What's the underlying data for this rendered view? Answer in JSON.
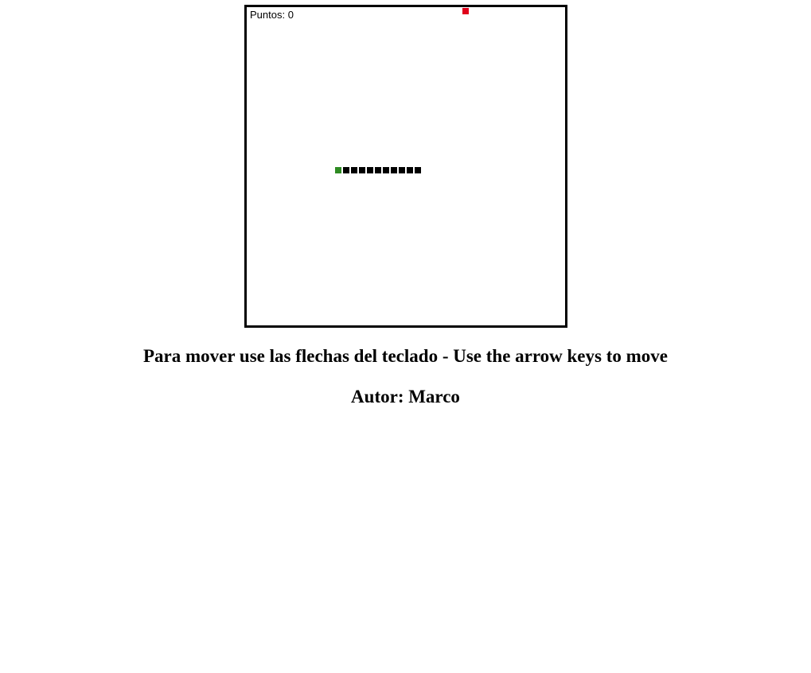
{
  "game": {
    "score_label": "Puntos: 0",
    "score": 0,
    "colors": {
      "board_border": "#000000",
      "snake_head": "#2e8b22",
      "snake_body": "#000000",
      "food": "#e0001b"
    },
    "grid_size": 40,
    "snake": {
      "direction": "left",
      "head": [
        11,
        20
      ],
      "body": [
        [
          12,
          20
        ],
        [
          13,
          20
        ],
        [
          14,
          20
        ],
        [
          15,
          20
        ],
        [
          16,
          20
        ],
        [
          17,
          20
        ],
        [
          18,
          20
        ],
        [
          19,
          20
        ],
        [
          20,
          20
        ],
        [
          21,
          20
        ]
      ]
    },
    "food": [
      27,
      0
    ]
  },
  "instructions": "Para mover use las flechas del teclado - Use the arrow keys to move",
  "author": "Autor: Marco"
}
